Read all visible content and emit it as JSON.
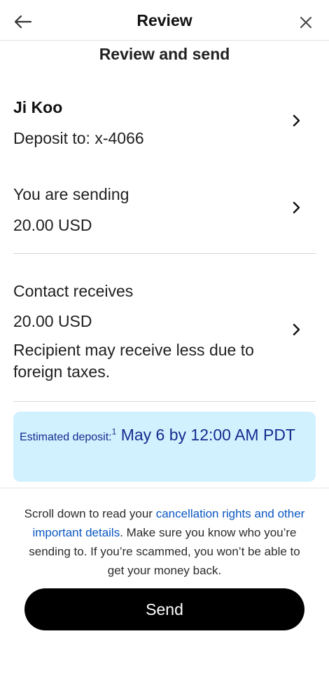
{
  "header": {
    "title": "Review",
    "back_icon": "arrow-left-icon",
    "close_icon": "close-icon"
  },
  "subtitle": "Review and send",
  "recipient": {
    "name": "Ji Koo",
    "deposit_to": "Deposit to: x-4066"
  },
  "sending": {
    "label": "You are sending",
    "amount": "20.00 USD"
  },
  "receives": {
    "label": "Contact receives",
    "amount": "20.00 USD",
    "note": "Recipient may receive less due to foreign taxes."
  },
  "estimated_deposit": {
    "label": "Estimated deposit:",
    "footnote": "1",
    "value": "May 6 by 12:00 AM PDT"
  },
  "disclaimer": {
    "prefix": "Scroll down to read your ",
    "link": "cancellation rights and other important details",
    "suffix": ". Make sure you know who you’re sending to. If you’re scammed, you won’t be able to get your money back."
  },
  "send_button": {
    "label": "Send"
  },
  "colors": {
    "accent_link": "#0a57c2",
    "deposit_card_bg": "#d1f1ff",
    "deposit_text": "#142c8e",
    "button_bg": "#000000"
  }
}
